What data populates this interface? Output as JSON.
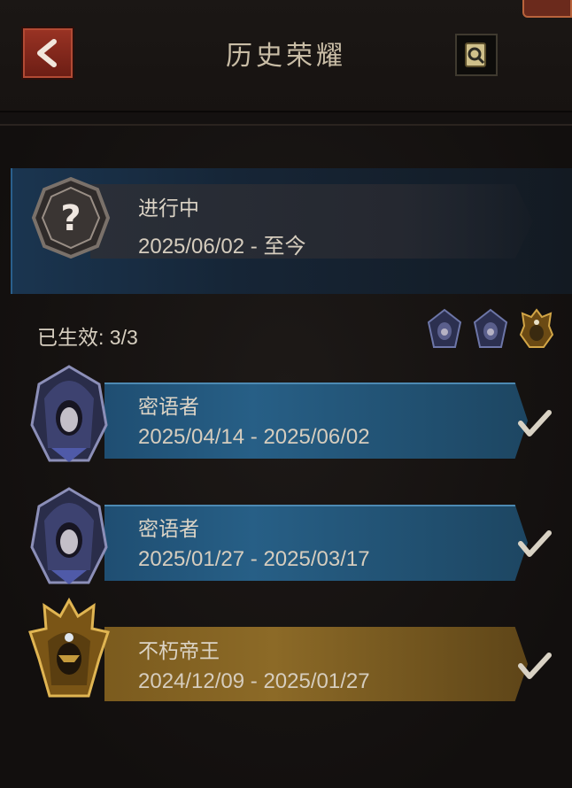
{
  "header": {
    "title": "历史荣耀"
  },
  "current": {
    "status": "进行中",
    "period": "2025/06/02 - 至今"
  },
  "active": {
    "label": "已生效: 3/3",
    "icons": [
      "whisperer-mini-icon",
      "whisperer-mini-icon",
      "immortal-emperor-mini-icon"
    ]
  },
  "records": [
    {
      "name": "密语者",
      "period": "2025/04/14 - 2025/06/02",
      "tier": "blue"
    },
    {
      "name": "密语者",
      "period": "2025/01/27 - 2025/03/17",
      "tier": "blue"
    },
    {
      "name": "不朽帝王",
      "period": "2024/12/09 - 2025/01/27",
      "tier": "gold"
    }
  ],
  "colors": {
    "blue_bar": "#275f86",
    "gold_bar": "#8c6a27",
    "back_button": "#9a3324",
    "check": "#d9d2c4"
  }
}
